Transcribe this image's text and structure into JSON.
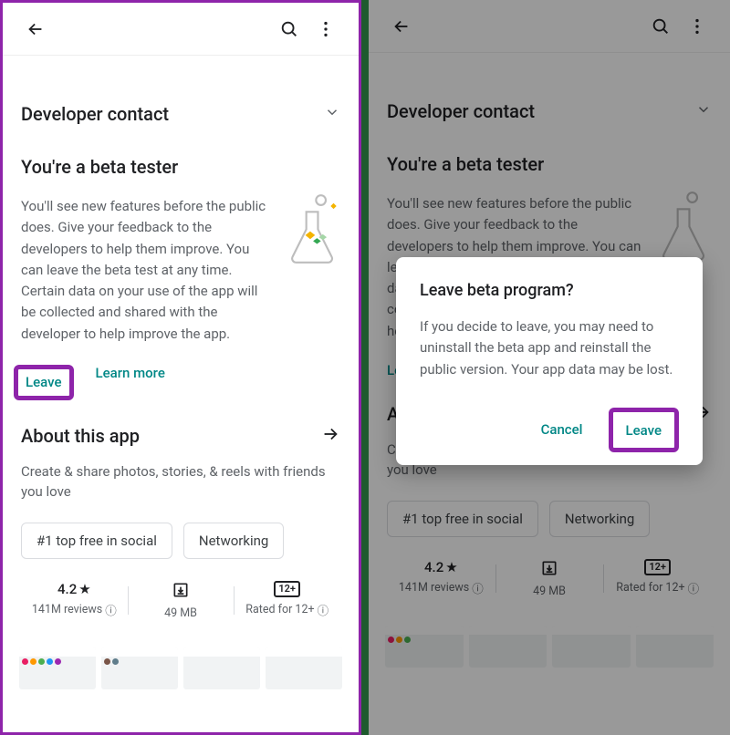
{
  "topbar": {
    "back": "back",
    "search": "search",
    "more": "more"
  },
  "dev_contact": {
    "title": "Developer contact"
  },
  "beta": {
    "title": "You're a beta tester",
    "text": "You'll see new features before the public does. Give your feedback to the developers to help them improve. You can leave the beta test at any time. Certain data on your use of the app will be collected and shared with the developer to help improve the app.",
    "leave": "Leave",
    "learn": "Learn more"
  },
  "about": {
    "title": "About this app",
    "text": "Create & share photos, stories, & reels with friends you love",
    "chips": [
      "#1 top free in social",
      "Networking"
    ]
  },
  "stats": {
    "rating": "4.2",
    "reviews": "141M reviews",
    "size": "49 MB",
    "rated_badge": "12+",
    "rated": "Rated for 12+"
  },
  "dialog": {
    "title": "Leave beta program?",
    "text": "If you decide to leave, you may need to uninstall the beta app and reinstall the public version. Your app data may be lost.",
    "cancel": "Cancel",
    "leave": "Leave"
  }
}
